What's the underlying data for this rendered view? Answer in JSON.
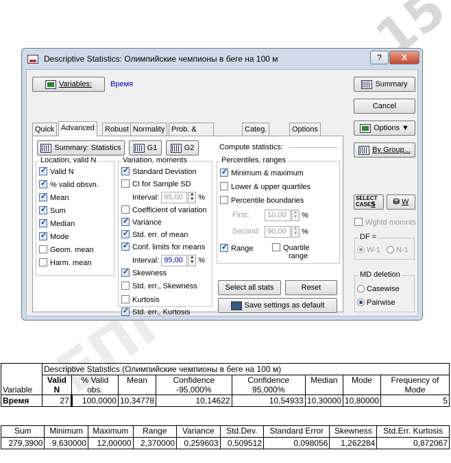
{
  "watermark": {
    "text1": "15",
    "text2": "ЕПГ"
  },
  "dialog": {
    "title": "Descriptive Statistics: Олимпийские чемпионы в беге на 100 м",
    "help_label": "?",
    "close_label": "X",
    "variables_label": "Variables:",
    "variables_value": "Время",
    "tabs": [
      "Quick",
      "Advanced",
      "Robust",
      "Normality",
      "Prob. & Scatterplots",
      "Categ. plots",
      "Options"
    ],
    "active_tab": "Advanced",
    "summary_stats_label": "Summary: Statistics",
    "g1_label": "G1",
    "g2_label": "G2",
    "location": {
      "title": "Location, valid N",
      "items": [
        {
          "label": "Valid N",
          "checked": true
        },
        {
          "label": "% valid obsvn.",
          "checked": true
        },
        {
          "label": "Mean",
          "checked": true
        },
        {
          "label": "Sum",
          "checked": true
        },
        {
          "label": "Median",
          "checked": true
        },
        {
          "label": "Mode",
          "checked": true
        },
        {
          "label": "Geom. mean",
          "checked": false
        },
        {
          "label": "Harm. mean",
          "checked": false
        }
      ]
    },
    "variation": {
      "title": "Variation, moments",
      "std_dev": "Standard Deviation",
      "ci_sd": "CI for Sample SD",
      "interval_label": "Interval:",
      "interval1": "95,00",
      "coef_var": "Coefficient of variation",
      "variance": "Variance",
      "std_err_mean": "Std. err. of mean",
      "conf_limits": "Conf. limits for means",
      "interval2": "95,00",
      "skewness": "Skewness",
      "std_err_skew": "Std. err., Skewness",
      "kurtosis": "Kurtosis",
      "std_err_kurt": "Std. err., Kurtosis",
      "percent": "%"
    },
    "compute_label": "Compute statistics:",
    "percentiles": {
      "title": "Percentiles, ranges",
      "min_max": "Minimum & maximum",
      "quartiles": "Lower & upper quartiles",
      "boundaries": "Percentile boundaries",
      "first_label": "First:",
      "first_value": "10,00",
      "second_label": "Second:",
      "second_value": "90,00",
      "range": "Range",
      "quartile_range1": "Quartile",
      "quartile_range2": "range"
    },
    "select_all": "Select all stats",
    "reset": "Reset",
    "save_defaults": "Save settings as default",
    "right": {
      "summary": "Summary",
      "cancel": "Cancel",
      "options": "Options",
      "by_group": "By Group...",
      "select_cases": "SELECT CASES",
      "s": "S",
      "w": "W",
      "wghtd": "Wghtd momnts",
      "df_title": "DF =",
      "df_w1": "W-1",
      "df_n1": "N-1",
      "md_title": "MD deletion",
      "casewise": "Casewise",
      "pairwise": "Pairwise"
    }
  },
  "table1": {
    "caption": "Descriptive Statistics (Олимпийские чемпионы в беге на 100 м)",
    "variable_header": "Variable",
    "headers": [
      "Valid N",
      "% Valid obs.",
      "Mean",
      "Confidence -95,000%",
      "Confidence 95,000%",
      "Median",
      "Mode",
      "Frequency of Mode"
    ],
    "row_label": "Время",
    "values": [
      "27",
      "100,0000",
      "10,34778",
      "10,14622",
      "10,54933",
      "10,30000",
      "10,80000",
      "5"
    ]
  },
  "table2": {
    "headers": [
      "Sum",
      "Minimum",
      "Maximum",
      "Range",
      "Variance",
      "Std.Dev.",
      "Standard Error",
      "Skewness",
      "Std.Err. Kurtosis"
    ],
    "values": [
      "279,3900",
      "9,630000",
      "12,00000",
      "2,370000",
      "0,259603",
      "0,509512",
      "0,098056",
      "1,262284",
      "0,872067"
    ]
  }
}
